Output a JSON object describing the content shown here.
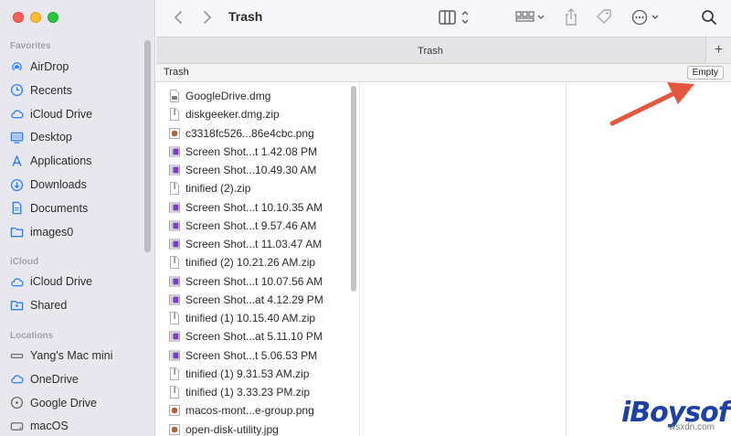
{
  "window": {
    "title": "Trash"
  },
  "toolbar": {
    "icons": [
      "chevron-left-icon",
      "chevron-right-icon",
      "column-view-icon",
      "group-icon",
      "share-icon",
      "tag-icon",
      "more-icon",
      "search-icon"
    ]
  },
  "tabbar": {
    "tab_label": "Trash",
    "add_tab": "+"
  },
  "pathbar": {
    "path": "Trash",
    "empty_button": "Empty"
  },
  "sidebar": {
    "favorites_header": "Favorites",
    "favorites": [
      {
        "label": "AirDrop",
        "icon": "airdrop-icon"
      },
      {
        "label": "Recents",
        "icon": "clock-icon"
      },
      {
        "label": "iCloud Drive",
        "icon": "cloud-icon"
      },
      {
        "label": "Desktop",
        "icon": "desktop-icon"
      },
      {
        "label": "Applications",
        "icon": "applications-icon"
      },
      {
        "label": "Downloads",
        "icon": "download-icon"
      },
      {
        "label": "Documents",
        "icon": "document-icon"
      },
      {
        "label": "images0",
        "icon": "folder-icon"
      }
    ],
    "icloud_header": "iCloud",
    "icloud": [
      {
        "label": "iCloud Drive",
        "icon": "cloud-icon"
      },
      {
        "label": "Shared",
        "icon": "shared-folder-icon"
      }
    ],
    "locations_header": "Locations",
    "locations": [
      {
        "label": "Yang's Mac mini",
        "icon": "computer-icon"
      },
      {
        "label": "OneDrive",
        "icon": "cloud-icon"
      },
      {
        "label": "Google Drive",
        "icon": "drive-icon"
      },
      {
        "label": "macOS",
        "icon": "disk-icon"
      }
    ]
  },
  "files": [
    {
      "name": "GoogleDrive.dmg",
      "kind": "dmg"
    },
    {
      "name": "diskgeeker.dmg.zip",
      "kind": "zip"
    },
    {
      "name": "c3318fc526...86e4cbc.png",
      "kind": "image"
    },
    {
      "name": "Screen Shot...t 1.42.08 PM",
      "kind": "screenshot"
    },
    {
      "name": "Screen Shot...10.49.30 AM",
      "kind": "screenshot"
    },
    {
      "name": "tinified (2).zip",
      "kind": "zip"
    },
    {
      "name": "Screen Shot...t 10.10.35 AM",
      "kind": "screenshot"
    },
    {
      "name": "Screen Shot...t 9.57.46 AM",
      "kind": "screenshot"
    },
    {
      "name": "Screen Shot...t 11.03.47 AM",
      "kind": "screenshot"
    },
    {
      "name": "tinified (2) 10.21.26 AM.zip",
      "kind": "zip"
    },
    {
      "name": "Screen Shot...t 10.07.56 AM",
      "kind": "screenshot"
    },
    {
      "name": "Screen Shot...at 4.12.29 PM",
      "kind": "screenshot"
    },
    {
      "name": "tinified (1) 10.15.40 AM.zip",
      "kind": "zip"
    },
    {
      "name": "Screen Shot...at 5.11.10 PM",
      "kind": "screenshot"
    },
    {
      "name": "Screen Shot...t 5.06.53 PM",
      "kind": "screenshot"
    },
    {
      "name": "tinified (1) 9.31.53 AM.zip",
      "kind": "zip"
    },
    {
      "name": "tinified (1) 3.33.23 PM.zip",
      "kind": "zip"
    },
    {
      "name": "macos-mont...e-group.png",
      "kind": "image"
    },
    {
      "name": "open-disk-utility.jpg",
      "kind": "image"
    }
  ],
  "watermark": {
    "brand": "iBoysoft",
    "site": "wsxdn.com"
  },
  "colors": {
    "accent": "#2f7cf6",
    "arrow": "#e8553f",
    "brand": "#1e3fa8"
  }
}
